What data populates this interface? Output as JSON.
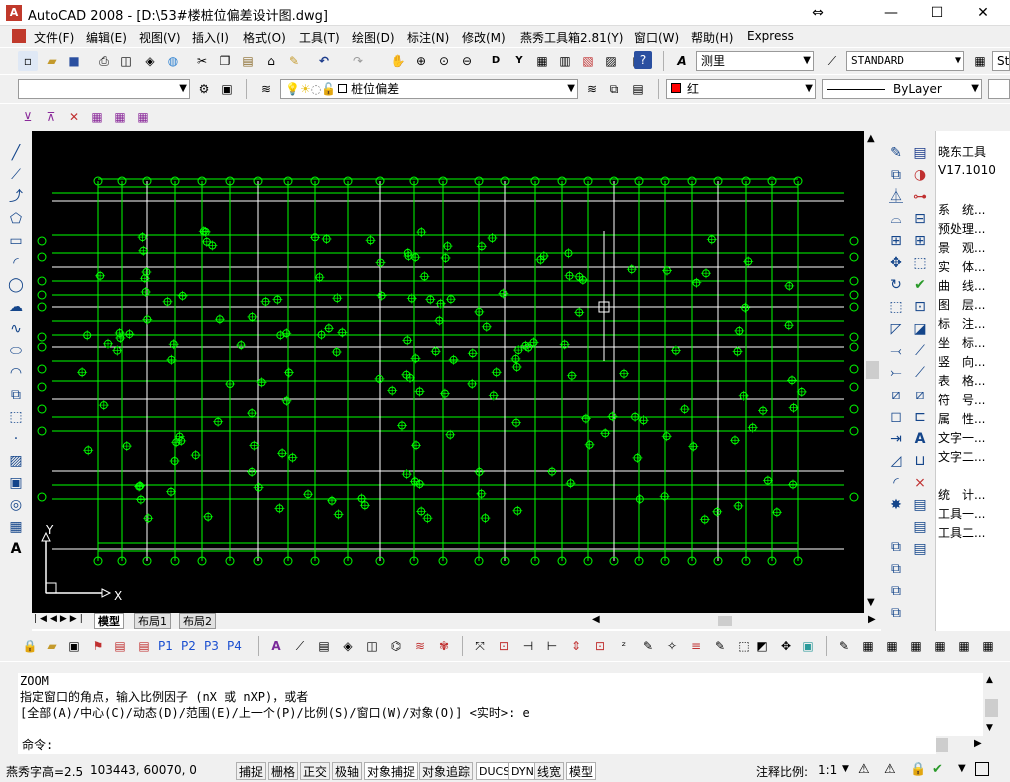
{
  "title": {
    "app_badge": "A",
    "text": "AutoCAD 2008 - [D:\\53#楼桩位偏差设计图.dwg]",
    "restore_glyph": "⇔",
    "minimize": "—",
    "maximize": "☐",
    "close": "✕"
  },
  "menu": [
    "文件(F)",
    "编辑(E)",
    "视图(V)",
    "插入(I)",
    "格式(O)",
    "工具(T)",
    "绘图(D)",
    "标注(N)",
    "修改(M)",
    "燕秀工具箱2.81(Y)",
    "窗口(W)",
    "帮助(H)",
    "Express"
  ],
  "toolbar1": {
    "text_style": "测里",
    "dim_style": "STANDARD",
    "table_style": "St"
  },
  "toolbar2": {
    "workspace": "",
    "layer": "桩位偏差",
    "color": "红",
    "linetype": "ByLayer"
  },
  "layout_tabs": [
    "模型",
    "布局1",
    "布局2"
  ],
  "yanxiu": {
    "title": "晓东工具",
    "version": "V17.1010",
    "items": [
      "系　统...",
      "预处理...",
      "景　观...",
      "实　体...",
      "曲　线...",
      "图　层...",
      "标　注...",
      "坐　标...",
      "竖　向...",
      "表　格...",
      "符　号...",
      "属　性...",
      "文字一...",
      "文字二...",
      "统　计...",
      "工具一...",
      "工具二..."
    ]
  },
  "bottom_toolbar": {
    "p_buttons": [
      "P1",
      "P2",
      "P3",
      "P4"
    ]
  },
  "command": {
    "lines": [
      "ZOOM",
      "指定窗口的角点，输入比例因子 (nX 或 nXP)，或者",
      "[全部(A)/中心(C)/动态(D)/范围(E)/上一个(P)/比例(S)/窗口(W)/对象(O)] <实时>: e"
    ],
    "prompt": "命令:"
  },
  "status": {
    "text_height": "燕秀字高=2.5",
    "coords": "103443, 60070, 0",
    "toggles": [
      "捕捉",
      "栅格",
      "正交",
      "极轴",
      "对象捕捉",
      "对象追踪",
      "DUCS",
      "DYN",
      "线宽",
      "模型"
    ],
    "annotation_scale_label": "注释比例:",
    "annotation_scale": "1:1"
  },
  "ucs": {
    "x": "X",
    "y": "Y"
  },
  "colors": {
    "canvas": "#000000",
    "grid_green": "#00ff00",
    "pile": "#00ff00",
    "white_line": "#ffffff",
    "layer_red": "#ff0000"
  },
  "chart_data": {
    "type": "scatter",
    "title": "",
    "xlabel": "",
    "ylabel": "",
    "note": "CAD plan view of pile layout with axis grid; piles drawn as crosshair circles",
    "piles": []
  }
}
